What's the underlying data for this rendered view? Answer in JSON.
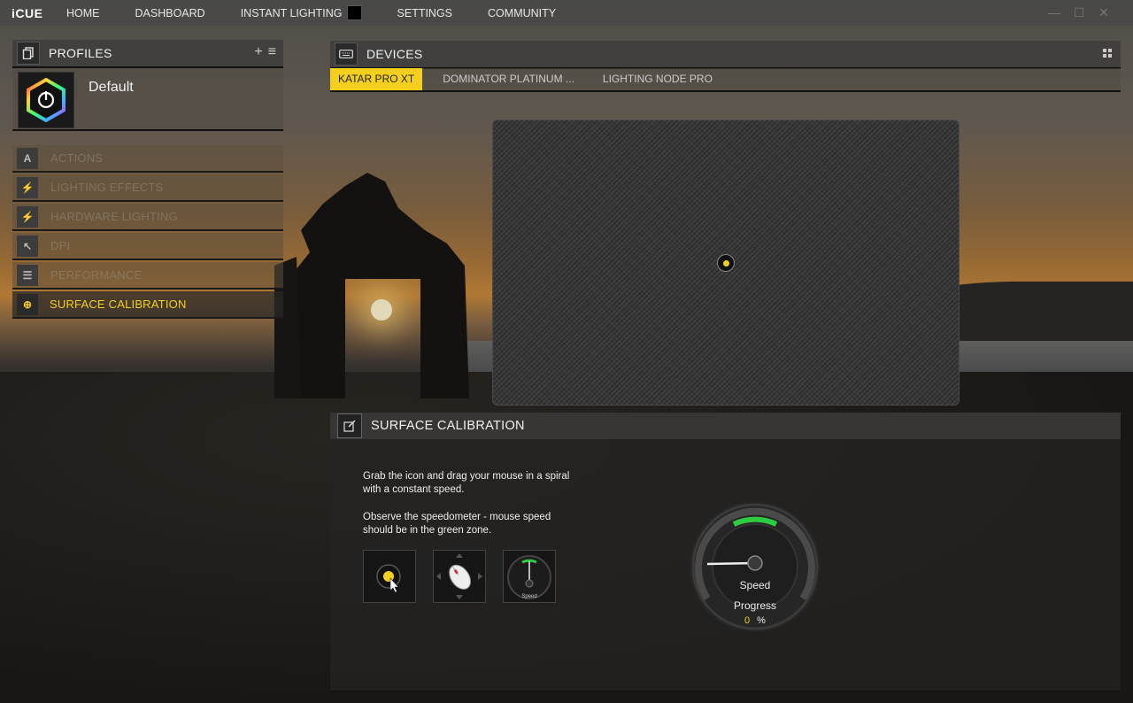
{
  "app": {
    "logo": "iCUE"
  },
  "nav": {
    "items": [
      {
        "label": "HOME"
      },
      {
        "label": "DASHBOARD"
      },
      {
        "label": "INSTANT LIGHTING"
      },
      {
        "label": "SETTINGS"
      },
      {
        "label": "COMMUNITY"
      }
    ],
    "instant_lighting_color": "#000000"
  },
  "window_controls": {
    "minimize": "—",
    "maximize": "☐",
    "close": "✕"
  },
  "profiles": {
    "title": "PROFILES",
    "add_label": "+",
    "menu_label": "≡",
    "current": {
      "name": "Default"
    }
  },
  "menu": {
    "items": [
      {
        "label": "ACTIONS",
        "icon": "A"
      },
      {
        "label": "LIGHTING EFFECTS",
        "icon": "⚡"
      },
      {
        "label": "HARDWARE LIGHTING",
        "icon": "⚡"
      },
      {
        "label": "DPI",
        "icon": "↖"
      },
      {
        "label": "PERFORMANCE",
        "icon": "☰"
      },
      {
        "label": "SURFACE CALIBRATION",
        "icon": "⊕"
      }
    ],
    "active_index": 5
  },
  "devices": {
    "title": "DEVICES",
    "tabs": [
      {
        "label": "KATAR PRO XT"
      },
      {
        "label": "DOMINATOR PLATINUM ..."
      },
      {
        "label": "LIGHTING NODE PRO"
      }
    ],
    "active_tab": 0
  },
  "calibration": {
    "title": "SURFACE CALIBRATION",
    "instruction_1": "Grab the icon and drag your mouse in a spiral with a constant speed.",
    "instruction_2": "Observe the speedometer - mouse speed should be in the green zone.",
    "step3_label": "Speed",
    "gauge": {
      "speed_label": "Speed",
      "progress_label": "Progress",
      "progress_value": "0",
      "progress_unit": "%"
    }
  },
  "colors": {
    "accent": "#f5cf1d",
    "green_zone": "#2ecc40"
  }
}
